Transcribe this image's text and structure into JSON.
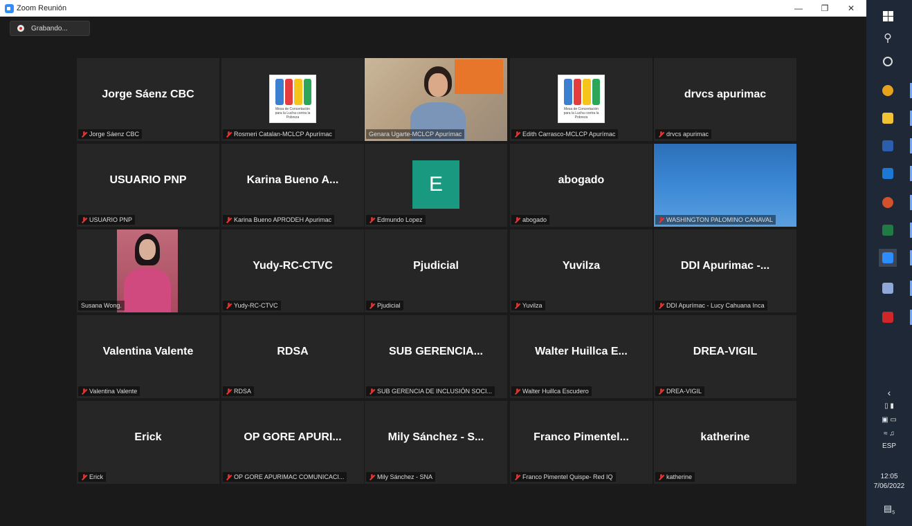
{
  "window": {
    "title": "Zoom Reunión"
  },
  "recording": {
    "label": "Grabando..."
  },
  "tiles": [
    {
      "name": "Jorge Sáenz CBC",
      "label": "Jorge Sáenz CBC",
      "kind": "name"
    },
    {
      "name": "",
      "label": "Rosmeri Catalan-MCLCP Apurímac",
      "kind": "logo"
    },
    {
      "name": "",
      "label": "Genara Ugarte-MCLCP Apurímac",
      "kind": "video1",
      "active": true
    },
    {
      "name": "",
      "label": "Edith Carrasco-MCLCP Apurímac",
      "kind": "logo"
    },
    {
      "name": "drvcs apurimac",
      "label": "drvcs apurimac",
      "kind": "name"
    },
    {
      "name": "USUARIO PNP",
      "label": "USUARIO PNP",
      "kind": "name"
    },
    {
      "name": "Karina Bueno A...",
      "label": "Karina Bueno APRODEH Apurimac",
      "kind": "name"
    },
    {
      "name": "E",
      "label": "Edmundo Lopez",
      "kind": "avatar"
    },
    {
      "name": "abogado",
      "label": "abogado",
      "kind": "name"
    },
    {
      "name": "",
      "label": "WASHINGTON PALOMINO CANAVAL",
      "kind": "sky"
    },
    {
      "name": "",
      "label": "Susana Wong.",
      "kind": "video2"
    },
    {
      "name": "Yudy-RC-CTVC",
      "label": "Yudy-RC-CTVC",
      "kind": "name"
    },
    {
      "name": "Pjudicial",
      "label": "Pjudicial",
      "kind": "name"
    },
    {
      "name": "Yuvilza",
      "label": "Yuvilza",
      "kind": "name"
    },
    {
      "name": "DDI Apurimac -...",
      "label": "DDI Apurímac - Lucy Cahuana Inca",
      "kind": "name"
    },
    {
      "name": "Valentina Valente",
      "label": "Valentina Valente",
      "kind": "name"
    },
    {
      "name": "RDSA",
      "label": "RDSA",
      "kind": "name"
    },
    {
      "name": "SUB GERENCIA...",
      "label": "SUB GERENCIA DE INCLUSIÓN SOCI...",
      "kind": "name"
    },
    {
      "name": "Walter Huillca E...",
      "label": "Walter Huillca Escudero",
      "kind": "name"
    },
    {
      "name": "DREA-VIGIL",
      "label": "DREA-VIGIL",
      "kind": "name"
    },
    {
      "name": "Erick",
      "label": "Erick",
      "kind": "name"
    },
    {
      "name": "OP GORE APURI...",
      "label": "OP GORE APURIMAC COMUNICACI...",
      "kind": "name"
    },
    {
      "name": "Mily Sánchez - S...",
      "label": "Mily Sánchez - SNA",
      "kind": "name"
    },
    {
      "name": "Franco Pimentel...",
      "label": "Franco Pimentel Quispe- Red IQ",
      "kind": "name"
    },
    {
      "name": "katherine",
      "label": "katherine",
      "kind": "name"
    }
  ],
  "logo": {
    "line1": "Mesa de Concertación",
    "line2": "para la Lucha contra la Pobreza"
  },
  "taskbar": {
    "icons": [
      "windows-icon",
      "search-icon",
      "cortana-icon",
      "chrome-icon",
      "file-explorer-icon",
      "word-icon",
      "outlook-icon",
      "powerpoint-icon",
      "excel-icon",
      "zoom-icon",
      "paint-icon",
      "acrobat-icon"
    ],
    "language": "ESP",
    "time": "12:05",
    "date": "7/06/2022",
    "notifications": "5"
  }
}
